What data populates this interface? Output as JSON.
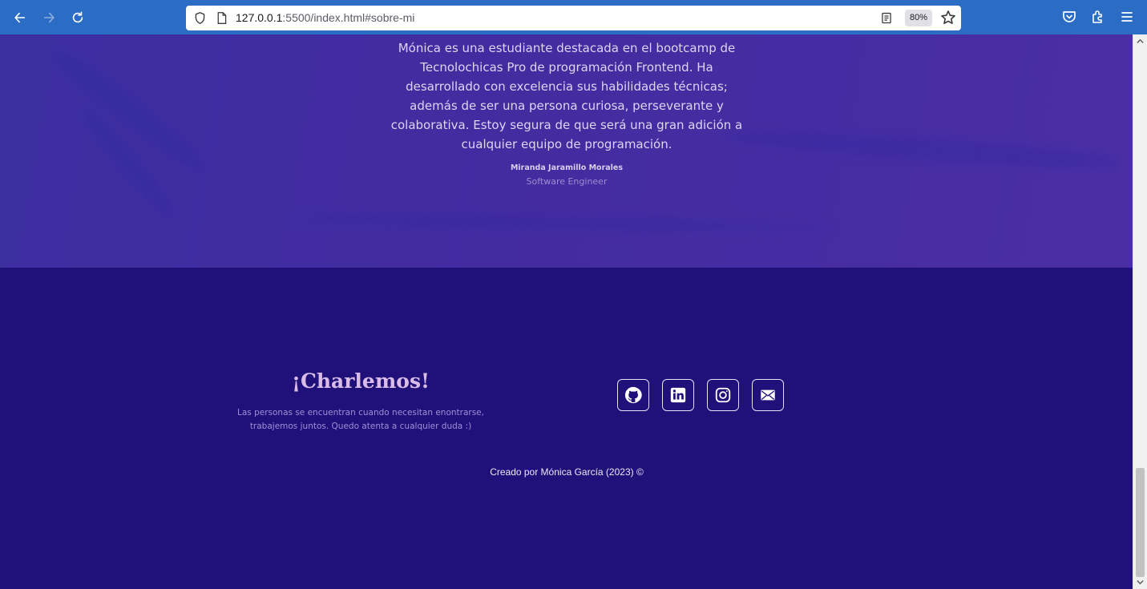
{
  "browser": {
    "url_host": "127.0.0.1",
    "url_path": ":5500/index.html#sobre-mi",
    "zoom": "80%",
    "icons": [
      "back-icon",
      "forward-icon",
      "reload-icon",
      "shield-icon",
      "page-icon",
      "reader-view-icon",
      "bookmark-star-icon",
      "pocket-icon",
      "extensions-icon",
      "menu-icon"
    ]
  },
  "testimonial": {
    "quote": "Mónica es una estudiante destacada en el bootcamp de Tecnolochicas Pro de programación Frontend. Ha desarrollado con excelencia sus habilidades técnicas; además de ser una persona curiosa, perseverante y colaborativa. Estoy segura de que será una gran adición a cualquier equipo de programación.",
    "author": "Miranda Jaramillo Morales",
    "role": "Software Engineer"
  },
  "contact": {
    "title": "¡Charlemos!",
    "text": "Las personas se encuentran cuando necesitan enontrarse, trabajemos juntos. Quedo atenta a cualquier duda :)",
    "socials": [
      "github-icon",
      "linkedin-icon",
      "instagram-icon",
      "email-icon"
    ]
  },
  "footer": {
    "credit": "Creado por Mónica García (2023) ©"
  },
  "colors": {
    "browser_bar": "#2b6cc4",
    "testimonial_bg": "#432ba0",
    "footer_bg": "#20117a",
    "title": "#d9bde8"
  }
}
